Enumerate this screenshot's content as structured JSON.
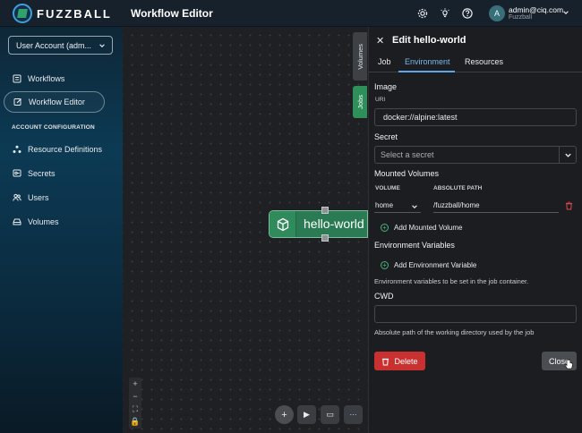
{
  "header": {
    "brand": "FUZZBALL",
    "title": "Workflow Editor",
    "user_initial": "A",
    "user_email": "admin@ciq.com",
    "user_org": "Fuzzball"
  },
  "sidebar": {
    "account_select": "User Account (adm...",
    "items": [
      {
        "label": "Workflows",
        "icon": "list-icon"
      },
      {
        "label": "Workflow Editor",
        "icon": "edit-icon"
      }
    ],
    "section_title": "ACCOUNT CONFIGURATION",
    "config_items": [
      {
        "label": "Resource Definitions",
        "icon": "triangle-nodes-icon"
      },
      {
        "label": "Secrets",
        "icon": "key-icon"
      },
      {
        "label": "Users",
        "icon": "users-icon"
      },
      {
        "label": "Volumes",
        "icon": "drive-icon"
      }
    ]
  },
  "canvas": {
    "side_tabs": [
      "Volumes",
      "Jobs"
    ],
    "node_label": "hello-world",
    "zoom_controls": [
      "+",
      "−",
      "⛶",
      "🔒"
    ],
    "toolbar": [
      "+",
      "▶",
      "▭",
      "···"
    ]
  },
  "panel": {
    "title": "Edit hello-world",
    "tabs": [
      "Job",
      "Environment",
      "Resources"
    ],
    "active_tab": "Environment",
    "image_section": "Image",
    "uri_label": "URI",
    "uri_value": "docker://alpine:latest",
    "secret_section": "Secret",
    "secret_placeholder": "Select a secret",
    "mounted_volumes_section": "Mounted Volumes",
    "volume_col": "VOLUME",
    "path_col": "ABSOLUTE PATH",
    "volume_value": "home",
    "path_value": "/fuzzball/home",
    "add_volume": "Add Mounted Volume",
    "env_section": "Environment Variables",
    "add_env": "Add Environment Variable",
    "env_help": "Environment variables to be set in the job container.",
    "cwd_section": "CWD",
    "cwd_value": "",
    "cwd_help": "Absolute path of the working directory used by the job",
    "delete_label": "Delete",
    "close_label": "Close"
  },
  "colors": {
    "accent_blue": "#5ea7e8",
    "node_green": "#2a7a53",
    "delete_red": "#c8312f"
  }
}
